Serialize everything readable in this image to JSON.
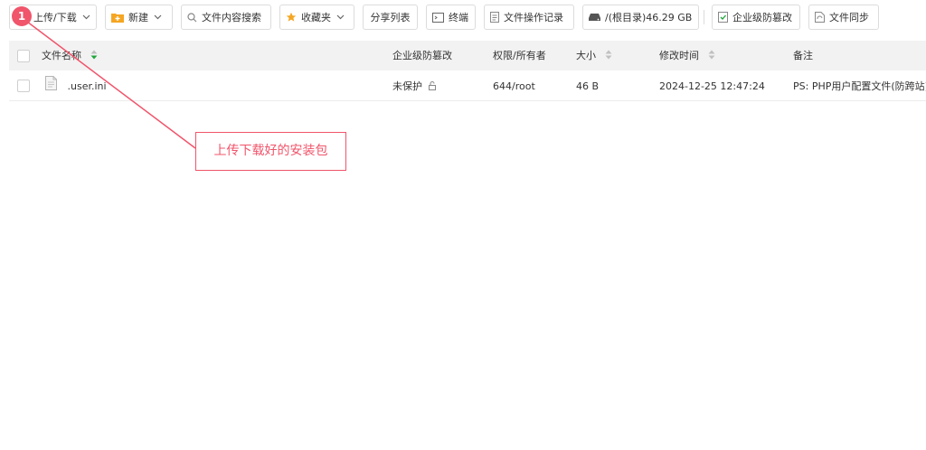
{
  "toolbar": {
    "upload": "上传/下载",
    "new": "新建",
    "search": "文件内容搜索",
    "favorites": "收藏夹",
    "share_list": "分享列表",
    "terminal": "终端",
    "op_log": "文件操作记录",
    "disk": "/(根目录)46.29 GB",
    "tamper": "企业级防篡改",
    "sync": "文件同步"
  },
  "table": {
    "headers": {
      "name": "文件名称",
      "tamper": "企业级防篡改",
      "perm": "权限/所有者",
      "size": "大小",
      "mtime": "修改时间",
      "note": "备注"
    },
    "rows": [
      {
        "name": ".user.ini",
        "tamper": "未保护",
        "perm": "644/root",
        "size": "46 B",
        "mtime": "2024-12-25 12:47:24",
        "note": "PS: PHP用户配置文件(防跨站)"
      }
    ]
  },
  "annotation": {
    "step": "1",
    "text": "上传下载好的安装包",
    "color": "#f0556b"
  },
  "colors": {
    "accent_orange": "#f5a623",
    "header_bg": "#f2f2f2",
    "sort_active": "#20a53a"
  }
}
